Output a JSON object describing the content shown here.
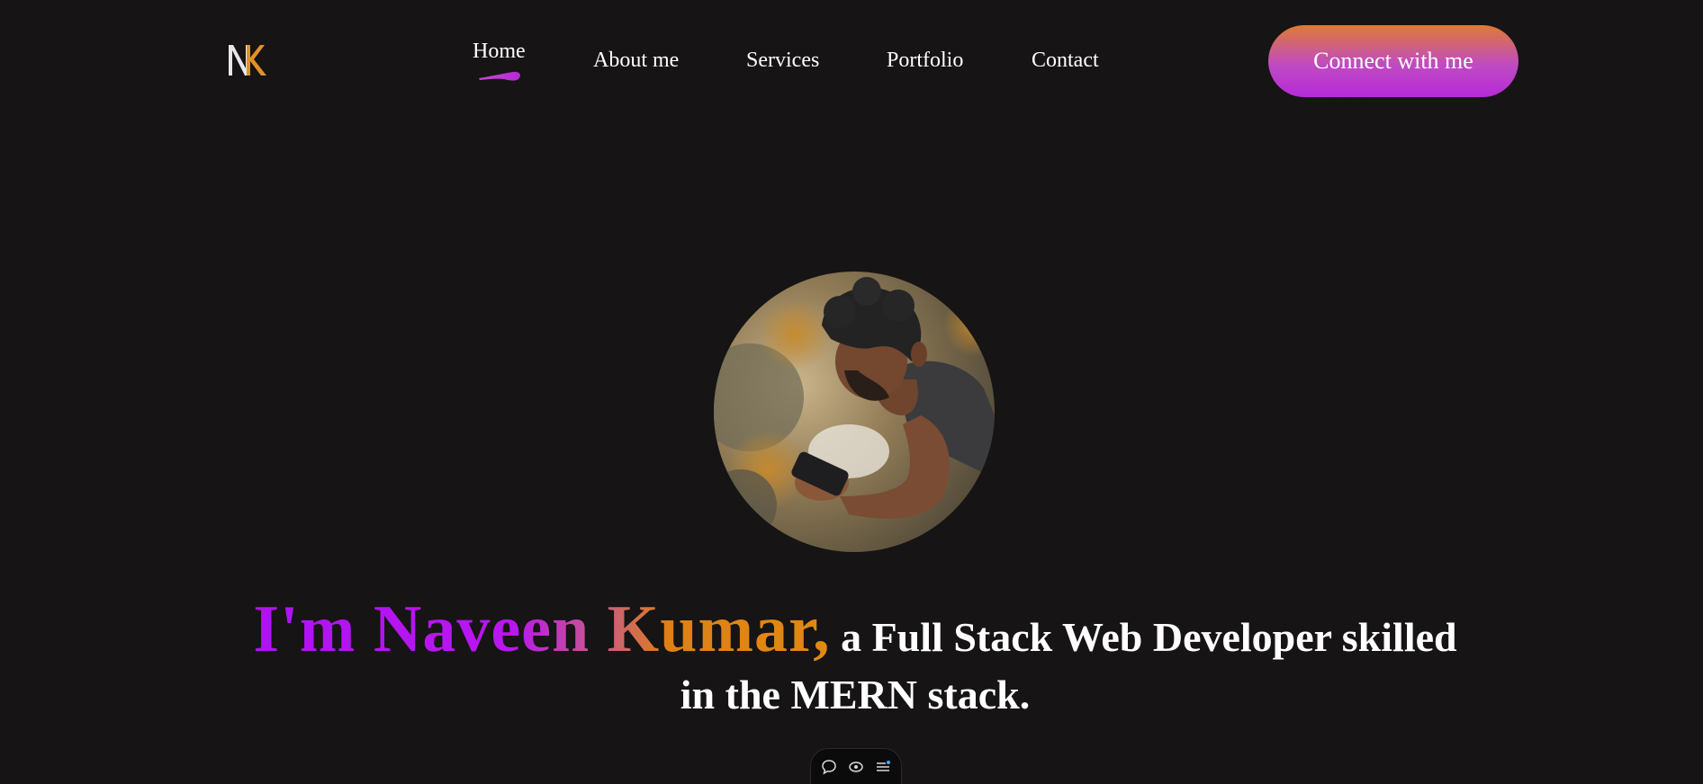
{
  "header": {
    "logo_alt": "NK",
    "nav": [
      {
        "label": "Home",
        "active": true
      },
      {
        "label": "About me",
        "active": false
      },
      {
        "label": "Services",
        "active": false
      },
      {
        "label": "Portfolio",
        "active": false
      },
      {
        "label": "Contact",
        "active": false
      }
    ],
    "cta_label": "Connect with me"
  },
  "hero": {
    "name": "I'm Naveen Kumar,",
    "tagline_line1": " a Full Stack Web Developer skilled",
    "tagline_line2": "in the MERN stack."
  },
  "toolbar": {
    "icons": [
      "comment-icon",
      "eye-icon",
      "list-icon"
    ]
  },
  "colors": {
    "background": "#161414",
    "accent_purple": "#b012f5",
    "accent_orange": "#e08a14",
    "cta_top": "#df7a34",
    "cta_bottom": "#b52ad8"
  }
}
